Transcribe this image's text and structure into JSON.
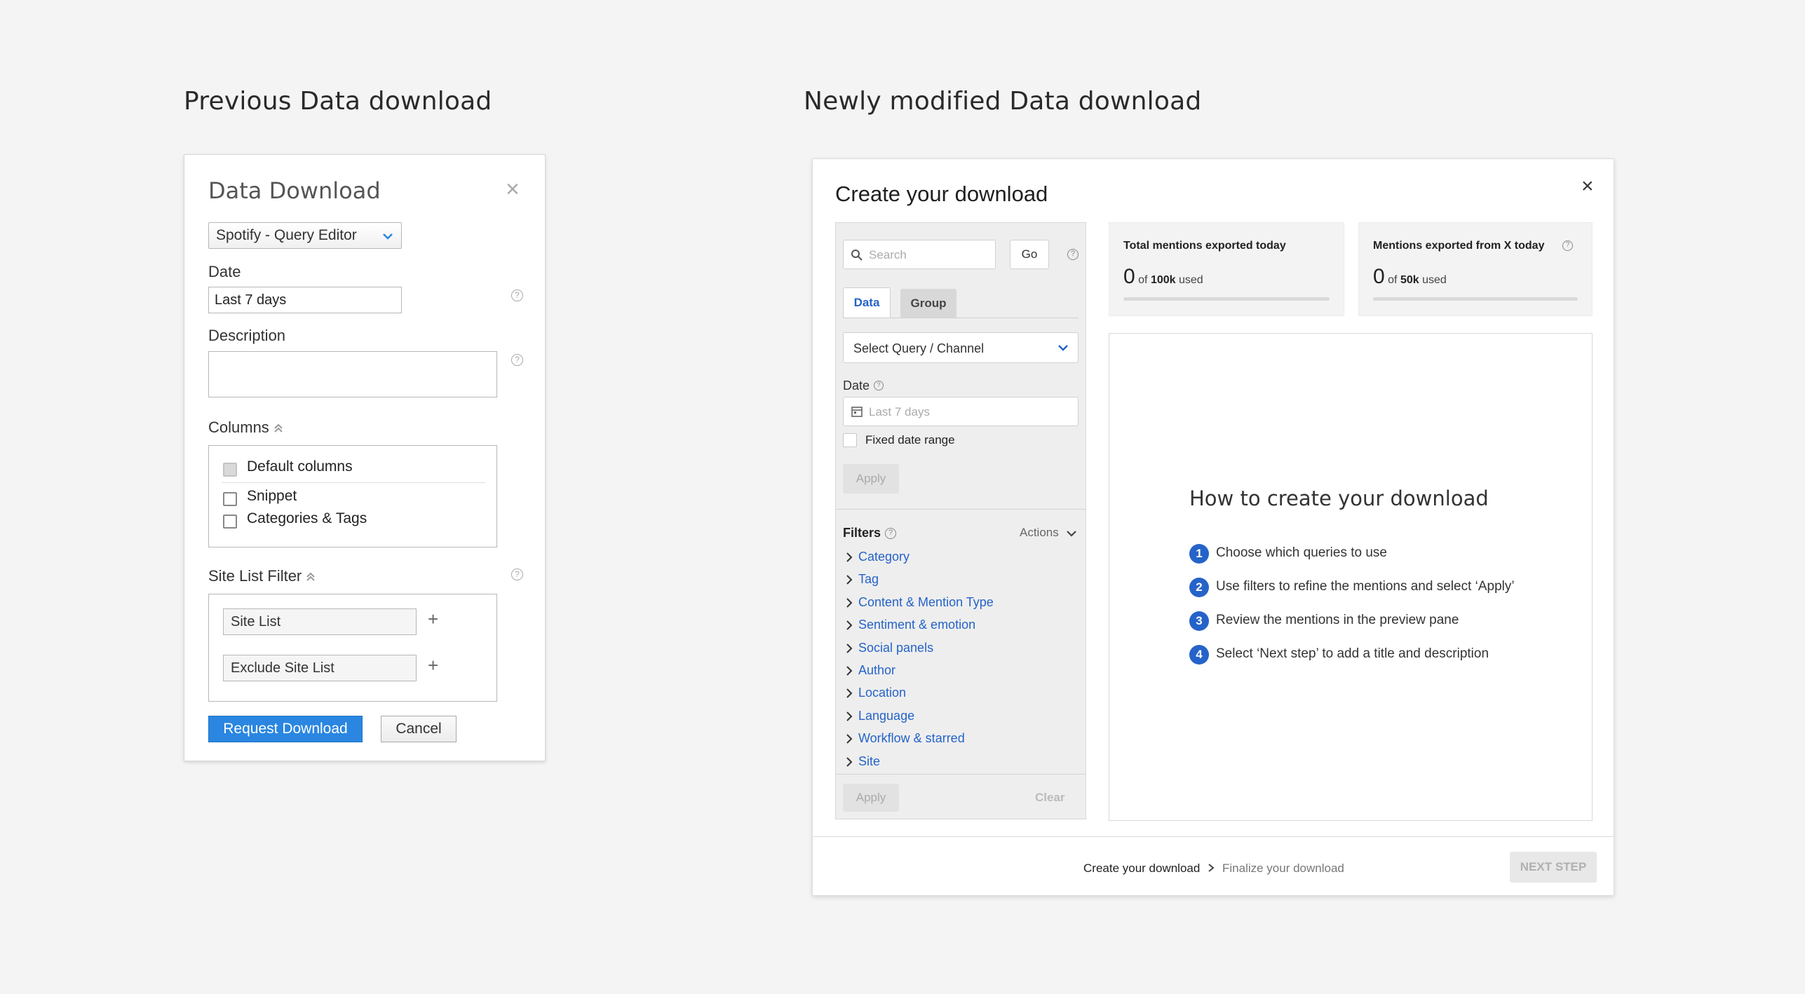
{
  "headings": {
    "previous": "Previous Data download",
    "new": "Newly modified Data download"
  },
  "old_dialog": {
    "title": "Data Download",
    "query_select": "Spotify - Query Editor",
    "date_label": "Date",
    "date_value": "Last 7 days",
    "description_label": "Description",
    "columns_label": "Columns",
    "columns": [
      "Default columns",
      "Snippet",
      "Categories & Tags"
    ],
    "site_filter_label": "Site List Filter",
    "site_list": "Site List",
    "exclude_site_list": "Exclude Site List",
    "request_button": "Request Download",
    "cancel_button": "Cancel",
    "help_glyph": "?",
    "plus_glyph": "+",
    "close_glyph": "×"
  },
  "new_dialog": {
    "title": "Create your download",
    "close_glyph": "×",
    "search_placeholder": "Search",
    "go_button": "Go",
    "tabs": [
      "Data",
      "Group"
    ],
    "query_select": "Select Query / Channel",
    "date_label": "Date",
    "date_placeholder": "Last 7 days",
    "fixed_date_range": "Fixed date range",
    "apply_button": "Apply",
    "filters_label": "Filters",
    "actions_label": "Actions",
    "filters": [
      "Category",
      "Tag",
      "Content & Mention Type",
      "Sentiment & emotion",
      "Social panels",
      "Author",
      "Location",
      "Language",
      "Workflow & starred",
      "Site"
    ],
    "bottom_apply": "Apply",
    "clear_button": "Clear",
    "stats": [
      {
        "title": "Total mentions exported today",
        "count": "0",
        "of": "of",
        "limit": "100k",
        "used": "used",
        "progress": 0
      },
      {
        "title": "Mentions exported from X today",
        "count": "0",
        "of": "of",
        "limit": "50k",
        "used": "used",
        "progress": 0
      }
    ],
    "howto_title": "How to create your download",
    "steps": [
      "Choose which queries to use",
      "Use filters to refine the mentions and select ‘Apply’",
      "Review the mentions in the preview pane",
      "Select ‘Next step’ to add a title and description"
    ],
    "step_numbers": [
      "1",
      "2",
      "3",
      "4"
    ],
    "breadcrumb": [
      "Create your download",
      "Finalize your download"
    ],
    "next_step": "NEXT STEP",
    "hint_glyph": "?",
    "colors": {
      "accent": "#2563c9",
      "primary_button": "#2a86e0"
    }
  }
}
